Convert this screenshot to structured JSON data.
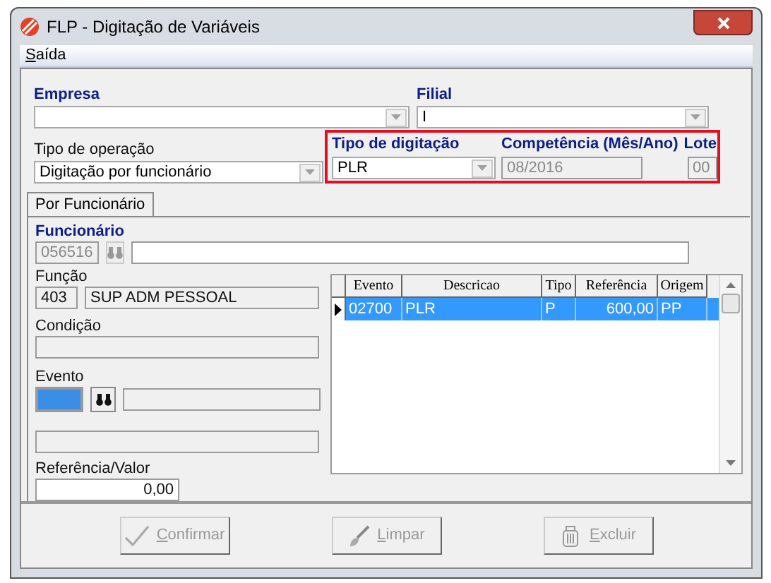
{
  "window": {
    "title": "FLP - Digitação de Variáveis"
  },
  "menu": [
    "Saída"
  ],
  "empresa": {
    "label": "Empresa"
  },
  "filial": {
    "label": "Filial",
    "value": "I"
  },
  "tipo_operacao": {
    "label": "Tipo de operação",
    "value": "Digitação por funcionário"
  },
  "tipo_digitacao": {
    "label": "Tipo de digitação",
    "value": "PLR"
  },
  "competencia": {
    "label": "Competência (Mês/Ano)",
    "value": "08/2016",
    "disabled": true
  },
  "lote": {
    "label": "Lote",
    "value": "00",
    "disabled": true
  },
  "tabs": [
    {
      "label": "Por Funcionário",
      "selected": true
    }
  ],
  "funcionario": {
    "label": "Funcionário",
    "code": "056516",
    "disabled": true
  },
  "funcao": {
    "label": "Função",
    "code": "403",
    "name": "SUP ADM PESSOAL"
  },
  "condicao": {
    "label": "Condição"
  },
  "evento": {
    "label": "Evento"
  },
  "referencia": {
    "label": "Referência/Valor",
    "value": "0,00"
  },
  "table": {
    "columns": [
      "Evento",
      "Descricao",
      "Tipo",
      "Referência",
      "Origem"
    ],
    "rows": [
      {
        "cells": [
          "02700",
          "PLR",
          "P",
          "600,00",
          "PP"
        ],
        "selected": true
      }
    ]
  },
  "buttons": [
    {
      "label": "Confirmar",
      "kind": "confirm",
      "disabled": true
    },
    {
      "label": "Limpar",
      "kind": "clear",
      "disabled": true
    },
    {
      "label": "Excluir",
      "kind": "delete",
      "disabled": true
    }
  ]
}
